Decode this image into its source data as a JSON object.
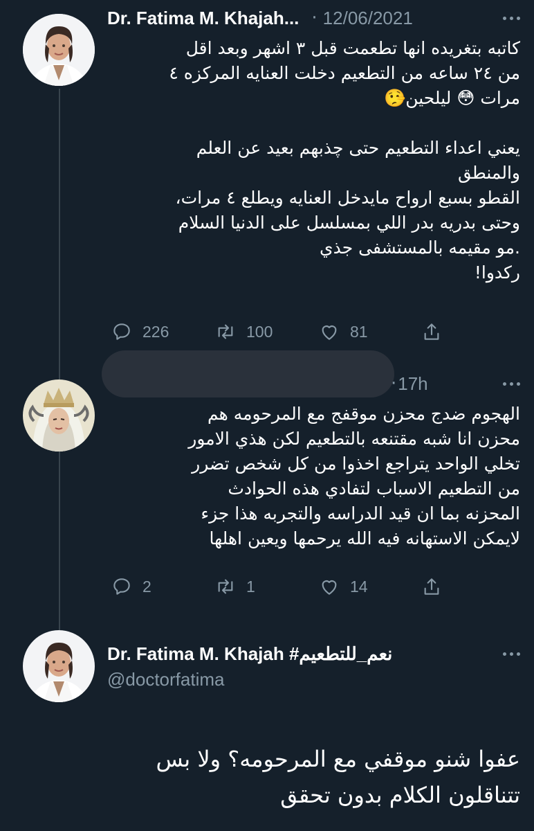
{
  "tweets": [
    {
      "author": "Dr. Fatima M. Khajah...",
      "date": "12/06/2021",
      "body_lines": [
        "كاتبه بتغريده انها تطعمت قبل ٣ اشهر وبعد اقل",
        "من ٢٤ ساعه من التطعيم دخلت العنايه المركزه ٤",
        "مرات 😳 ليلحين🤥",
        "",
        "يعني اعداء التطعيم حتى چذبهم بعيد عن العلم",
        "والمنطق",
        "القطو بسبع ارواح مايدخل العنايه ويطلع ٤ مرات،",
        "وحتى بدريه بدر اللي بمسلسل على الدنيا السلام",
        ".مو مقيمه بالمستشفى جذي",
        "ركدوا!"
      ],
      "replies": "226",
      "retweets": "100",
      "likes": "81"
    },
    {
      "author": "",
      "date": "17h",
      "body_lines": [
        "الهجوم ضدج محزن موقفج مع المرحومه هم",
        "محزن انا شبه مقتنعه بالتطعيم لكن هذي الامور",
        "تخلي الواحد يتراجع اخذوا من كل شخص تضرر",
        "من التطعيم الاسباب لتفادي هذه الحوادث",
        "المحزنه بما ان قيد الدراسه والتجربه هذا جزء",
        "لايمكن الاستهانه فيه الله يرحمها ويعين اهلها"
      ],
      "replies": "2",
      "retweets": "1",
      "likes": "14"
    }
  ],
  "main_tweet": {
    "author": "Dr. Fatima M. Khajah #نعم_للتطعيم",
    "handle": "@doctorfatima",
    "body_lines": [
      "عفوا شنو موقفي مع المرحومه؟ ولا بس",
      "تتناقلون الكلام بدون تحقق"
    ]
  },
  "icons": {
    "reply": "reply-icon",
    "retweet": "retweet-icon",
    "like": "heart-icon",
    "share": "share-icon",
    "more": "more-dots-icon"
  },
  "colors": {
    "background": "#15202b",
    "secondary_text": "#8899a6",
    "thread_line": "#38444d"
  }
}
